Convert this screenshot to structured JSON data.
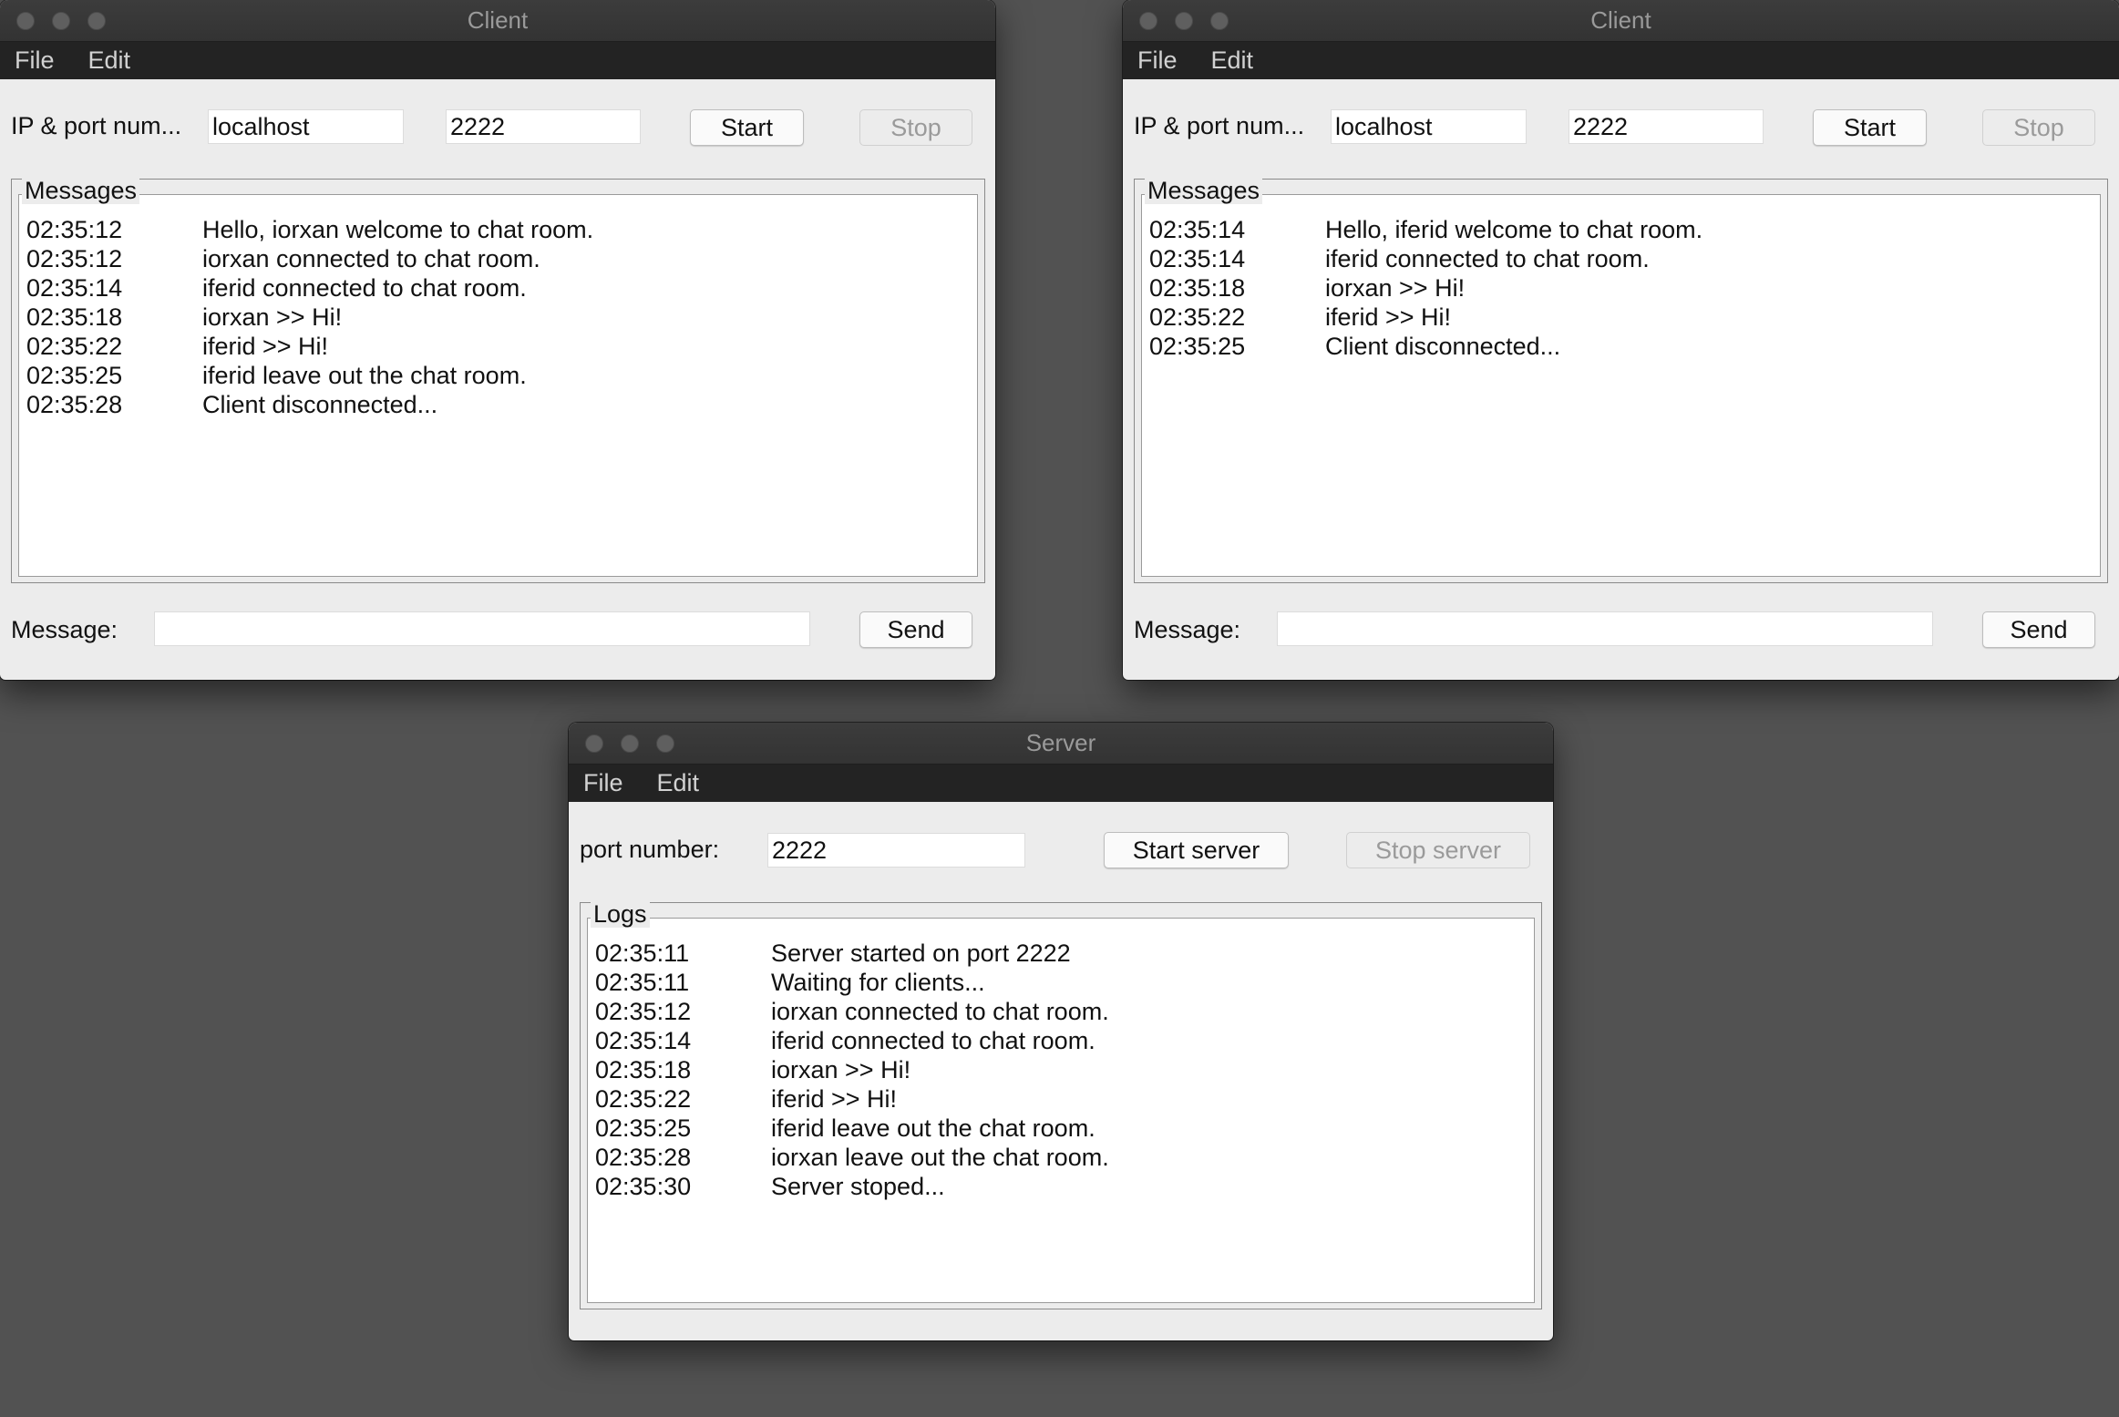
{
  "client1": {
    "title": "Client",
    "menu": [
      "File",
      "Edit"
    ],
    "ip_label": "IP & port num...",
    "host_value": "localhost",
    "port_value": "2222",
    "start_label": "Start",
    "stop_label": "Stop",
    "messages_legend": "Messages",
    "messages": [
      {
        "time": "02:35:12",
        "text": "Hello, iorxan welcome to chat room."
      },
      {
        "time": "02:35:12",
        "text": "iorxan connected to chat room."
      },
      {
        "time": "02:35:14",
        "text": "iferid connected to chat room."
      },
      {
        "time": "02:35:18",
        "text": "iorxan >> Hi!"
      },
      {
        "time": "02:35:22",
        "text": "iferid >> Hi!"
      },
      {
        "time": "02:35:25",
        "text": "iferid leave out the chat room."
      },
      {
        "time": "02:35:28",
        "text": "Client disconnected..."
      }
    ],
    "message_label": "Message:",
    "message_value": "",
    "send_label": "Send"
  },
  "client2": {
    "title": "Client",
    "menu": [
      "File",
      "Edit"
    ],
    "ip_label": "IP & port num...",
    "host_value": "localhost",
    "port_value": "2222",
    "start_label": "Start",
    "stop_label": "Stop",
    "messages_legend": "Messages",
    "messages": [
      {
        "time": "02:35:14",
        "text": "Hello, iferid welcome to chat room."
      },
      {
        "time": "02:35:14",
        "text": "iferid connected to chat room."
      },
      {
        "time": "02:35:18",
        "text": "iorxan >> Hi!"
      },
      {
        "time": "02:35:22",
        "text": "iferid >> Hi!"
      },
      {
        "time": "02:35:25",
        "text": "Client disconnected..."
      }
    ],
    "message_label": "Message:",
    "message_value": "",
    "send_label": "Send"
  },
  "server": {
    "title": "Server",
    "menu": [
      "File",
      "Edit"
    ],
    "port_label": "port number:",
    "port_value": "2222",
    "start_label": "Start server",
    "stop_label": "Stop server",
    "logs_legend": "Logs",
    "logs": [
      {
        "time": "02:35:11",
        "text": "Server started on port 2222"
      },
      {
        "time": "02:35:11",
        "text": "Waiting for clients..."
      },
      {
        "time": "02:35:12",
        "text": "iorxan connected to chat room."
      },
      {
        "time": "02:35:14",
        "text": "iferid connected to chat room."
      },
      {
        "time": "02:35:18",
        "text": "iorxan >> Hi!"
      },
      {
        "time": "02:35:22",
        "text": "iferid >> Hi!"
      },
      {
        "time": "02:35:25",
        "text": "iferid leave out the chat room."
      },
      {
        "time": "02:35:28",
        "text": "iorxan leave out the chat room."
      },
      {
        "time": "02:35:30",
        "text": "Server stoped..."
      }
    ]
  }
}
